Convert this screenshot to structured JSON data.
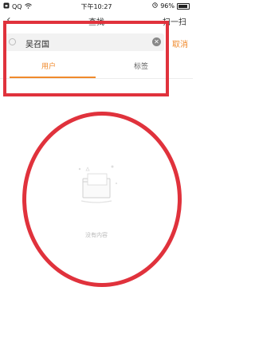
{
  "status_bar": {
    "carrier": "QQ",
    "time": "下午10:27",
    "battery": "96%"
  },
  "header": {
    "title": "查找",
    "scan_label": "扫一扫"
  },
  "search": {
    "value": "吴召国",
    "cancel_label": "取消"
  },
  "tabs": [
    {
      "label": "用户",
      "active": true
    },
    {
      "label": "标签",
      "active": false
    }
  ],
  "empty_state": {
    "text": "没有内容"
  },
  "colors": {
    "accent": "#f08a2c",
    "annotation": "#e0323c"
  }
}
